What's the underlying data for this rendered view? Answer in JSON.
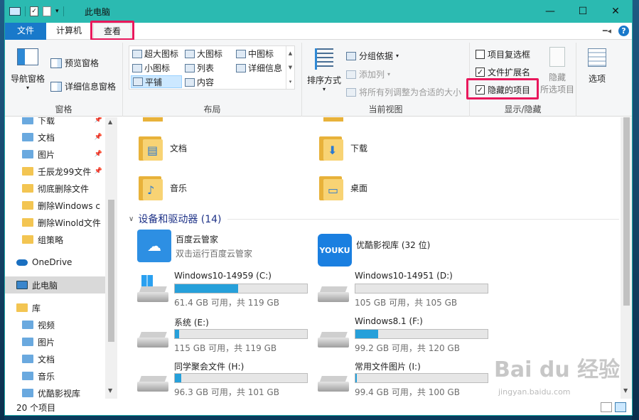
{
  "window": {
    "title": "此电脑"
  },
  "tabs": {
    "file": "文件",
    "computer": "计算机",
    "view": "查看"
  },
  "ribbon": {
    "panes": {
      "nav_pane": "导航窗格",
      "preview_pane": "预览窗格",
      "details_pane": "详细信息窗格",
      "label": "窗格"
    },
    "layout": {
      "items": [
        "超大图标",
        "大图标",
        "中图标",
        "小图标",
        "列表",
        "详细信息",
        "平铺",
        "内容"
      ],
      "selected": "平铺",
      "label": "布局"
    },
    "current_view": {
      "sort": "排序方式",
      "group_by": "分组依据",
      "add_column": "添加列",
      "fit_columns": "将所有列调整为合适的大小",
      "label": "当前视图"
    },
    "show_hide": {
      "item_checkbox": "项目复选框",
      "file_ext": "文件扩展名",
      "hidden_items": "隐藏的项目",
      "hide_selected_1": "隐藏",
      "hide_selected_2": "所选项目",
      "label": "显示/隐藏",
      "checked": {
        "item_checkbox": false,
        "file_ext": true,
        "hidden_items": true
      }
    },
    "options": "选项"
  },
  "nav": {
    "items": [
      {
        "label": "下载",
        "icon": "download-icon",
        "pinned": true
      },
      {
        "label": "文档",
        "icon": "document-icon",
        "pinned": true
      },
      {
        "label": "图片",
        "icon": "pictures-icon",
        "pinned": true
      },
      {
        "label": "壬辰龙99文件",
        "icon": "folder-icon",
        "pinned": true
      },
      {
        "label": "彻底删除文件",
        "icon": "folder-icon",
        "pinned": false
      },
      {
        "label": "删除Windows c",
        "icon": "folder-icon",
        "pinned": false
      },
      {
        "label": "删除Winold文件",
        "icon": "folder-icon",
        "pinned": false
      },
      {
        "label": "组策略",
        "icon": "folder-icon",
        "pinned": false
      },
      {
        "label": "OneDrive",
        "icon": "cloud-icon",
        "pinned": false
      },
      {
        "label": "此电脑",
        "icon": "computer-icon",
        "pinned": false
      },
      {
        "label": "库",
        "icon": "library-icon",
        "pinned": false
      },
      {
        "label": "视频",
        "icon": "video-icon",
        "pinned": false
      },
      {
        "label": "图片",
        "icon": "pictures-icon",
        "pinned": false
      },
      {
        "label": "文档",
        "icon": "document-icon",
        "pinned": false
      },
      {
        "label": "音乐",
        "icon": "music-icon",
        "pinned": false
      },
      {
        "label": "优酷影视库",
        "icon": "youku-icon",
        "pinned": false
      }
    ]
  },
  "folders": [
    {
      "label": "文档",
      "icon": "document-folder-icon"
    },
    {
      "label": "下载",
      "icon": "download-folder-icon"
    },
    {
      "label": "音乐",
      "icon": "music-folder-icon"
    },
    {
      "label": "桌面",
      "icon": "desktop-folder-icon"
    }
  ],
  "devices": {
    "header": "设备和驱动器 (14)",
    "apps": [
      {
        "name": "百度云管家",
        "sub": "双击运行百度云管家"
      },
      {
        "name": "优酷影视库 (32 位)",
        "sub": ""
      }
    ],
    "app_icon_text": {
      "youku": "YOUKU"
    },
    "drives": [
      {
        "name": "Windows10-14959 (C:)",
        "info": "61.4 GB 可用，共 119 GB",
        "used_pct": 48,
        "system": true
      },
      {
        "name": "Windows10-14951 (D:)",
        "info": "105 GB 可用，共 105 GB",
        "used_pct": 0,
        "system": false
      },
      {
        "name": "系统 (E:)",
        "info": "115 GB 可用，共 119 GB",
        "used_pct": 3,
        "system": false
      },
      {
        "name": "Windows8.1 (F:)",
        "info": "99.2 GB 可用，共 120 GB",
        "used_pct": 17,
        "system": false
      },
      {
        "name": "同学聚会文件 (H:)",
        "info": "96.3 GB 可用，共 101 GB",
        "used_pct": 5,
        "system": false
      },
      {
        "name": "常用文件图片 (I:)",
        "info": "99.4 GB 可用，共 100 GB",
        "used_pct": 1,
        "system": false
      }
    ]
  },
  "status": {
    "count": "20 个项目"
  },
  "watermark": {
    "text": "Bai du 经验",
    "sub": "jingyan.baidu.com"
  },
  "colors": {
    "title_bar": "#2bbab1",
    "file_tab": "#1979ca",
    "highlight": "#e8185c",
    "drive_fill": "#26a0da"
  }
}
